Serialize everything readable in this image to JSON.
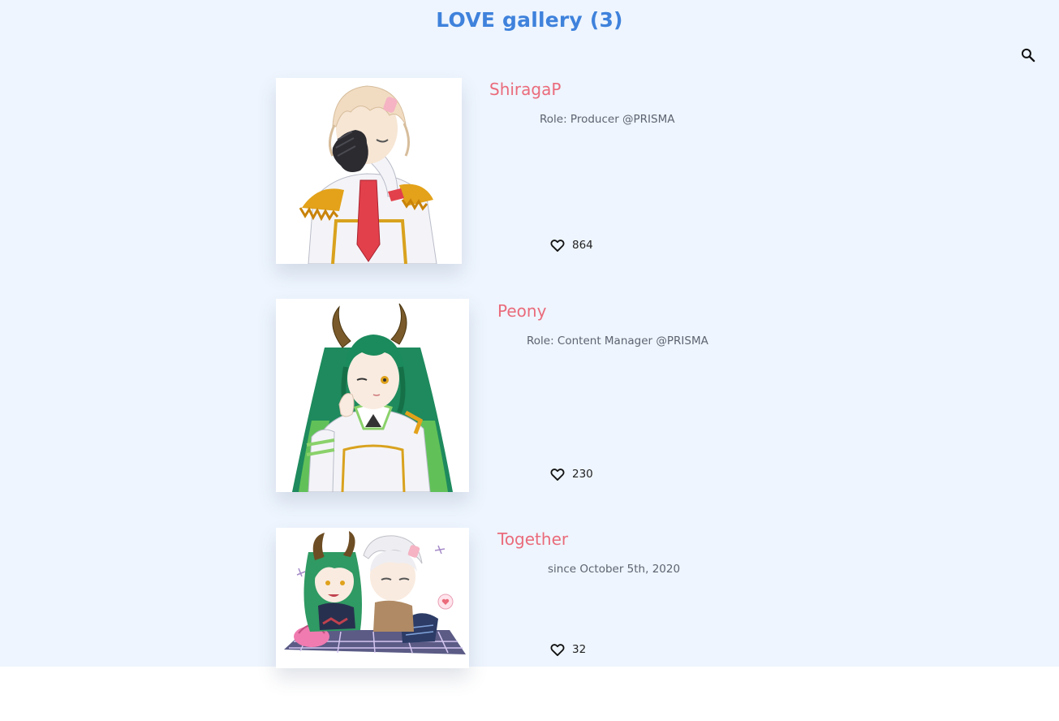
{
  "header": {
    "title": "LOVE gallery (3)",
    "search_icon": "search-icon"
  },
  "cards": [
    {
      "name": "ShiragaP",
      "subtitle": "Role: Producer @PRISMA",
      "likes": "864",
      "image": "white-haired anime character in white military uniform with gold epaulettes and red tie, covering one eye with black-gloved hand",
      "like_icon": "heart-outline-icon"
    },
    {
      "name": "Peony",
      "subtitle": "Role: Content Manager @PRISMA",
      "likes": "230",
      "image": "green-haired anime character with curved horns in white uniform, winking",
      "like_icon": "heart-outline-icon"
    },
    {
      "name": "Together",
      "subtitle": "since October 5th, 2020",
      "likes": "32",
      "image": "chibi couple (green-haired horned girl and white-haired boy) sitting on a plaid picnic blanket with bags",
      "like_icon": "heart-outline-icon"
    }
  ],
  "colors": {
    "background": "#eef5fe",
    "title_blue": "#3f82dc",
    "card_title_pink": "#ea6b7b",
    "subtitle_gray": "#5d6470"
  }
}
